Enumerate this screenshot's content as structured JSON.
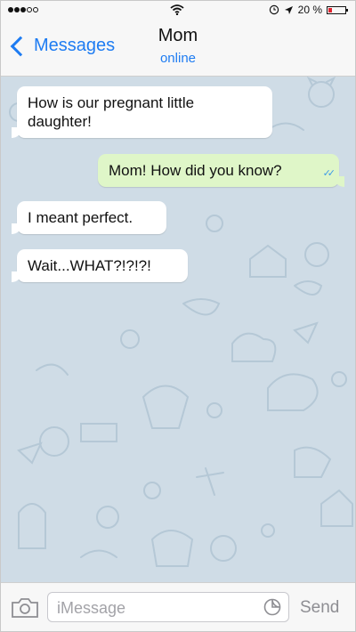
{
  "status_bar": {
    "battery_text": "20 %"
  },
  "nav": {
    "back_label": "Messages",
    "title": "Mom",
    "subtitle": "online"
  },
  "messages": [
    {
      "direction": "incoming",
      "text": "How is our pregnant little daughter!"
    },
    {
      "direction": "outgoing",
      "text": "Mom! How did you know?",
      "status": "read"
    },
    {
      "direction": "incoming",
      "text": "I meant perfect."
    },
    {
      "direction": "incoming",
      "text": "Wait...WHAT?!?!?!"
    }
  ],
  "composer": {
    "placeholder": "iMessage",
    "send_label": "Send"
  },
  "colors": {
    "accent": "#1e7cf2",
    "chat_background": "#cfdce6",
    "outgoing_bubble": "#dff6c8",
    "incoming_bubble": "#ffffff",
    "battery_low": "#e0242f"
  },
  "icons": [
    "signal-dots-icon",
    "wifi-icon",
    "alarm-icon",
    "location-arrow-icon",
    "battery-icon",
    "chevron-left-icon",
    "double-check-icon",
    "camera-icon",
    "sticker-icon"
  ]
}
